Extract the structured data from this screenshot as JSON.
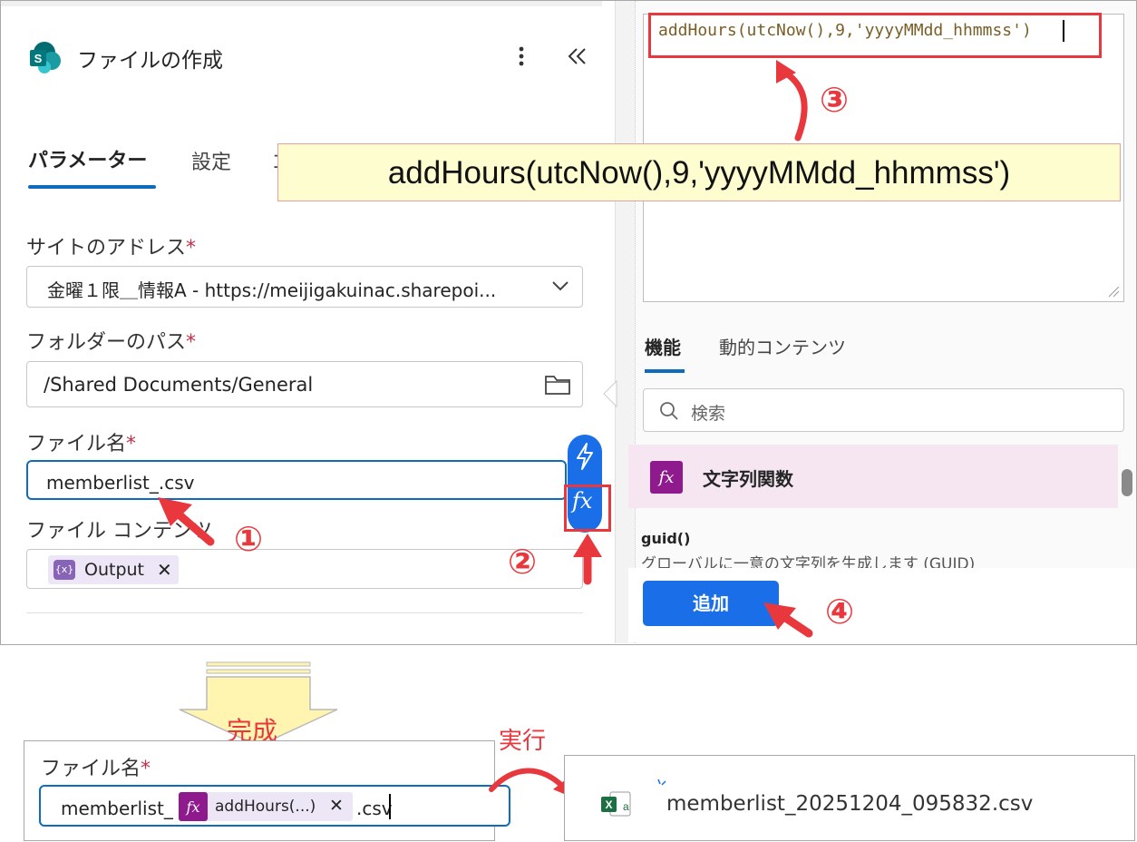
{
  "left": {
    "title": "ファイルの作成",
    "tabs": [
      "パラメーター",
      "設定",
      "コ"
    ],
    "site_label": "サイトのアドレス",
    "site_value": "金曜１限＿情報A - https://meijigakuinac.sharepoi...",
    "folder_label": "フォルダーのパス",
    "folder_value": "/Shared Documents/General",
    "filename_label": "ファイル名",
    "filename_value": "memberlist_.csv",
    "content_label": "ファイル コンテンツ",
    "content_tag": "Output",
    "required_mark": "*"
  },
  "right": {
    "expression": "addHours(utcNow(),9,'yyyyMMdd_hhmmss')",
    "tabs": [
      "機能",
      "動的コンテンツ"
    ],
    "search_placeholder": "検索",
    "category": "文字列関数",
    "func_name": "guid()",
    "func_desc": "グローバルに一意の文字列を生成します (GUID)",
    "add_button": "追加"
  },
  "callout": {
    "text": "addHours(utcNow(),9,'yyyyMMdd_hhmmss')"
  },
  "steps": [
    "①",
    "②",
    "③",
    "④"
  ],
  "bottom": {
    "done_label": "完成",
    "run_label": "実行",
    "filename_label": "ファイル名",
    "required_mark": "*",
    "prefix": "memberlist_",
    "token": "addHours(...)",
    "suffix": ".csv",
    "result_file": "memberlist_20251204_095832.csv"
  },
  "colors": {
    "accent": "#0f6cbd",
    "annotation_red": "#e8383d",
    "callout_bg": "#fdfdd0",
    "fx_purple": "#8e1a8e",
    "excel_green": "#1d6f42"
  },
  "icons": [
    "sharepoint-logo-icon",
    "more-vertical-icon",
    "collapse-icon",
    "chevron-down-icon",
    "folder-icon",
    "lightning-icon",
    "fx-icon",
    "search-icon",
    "excel-file-icon",
    "remove-icon"
  ]
}
